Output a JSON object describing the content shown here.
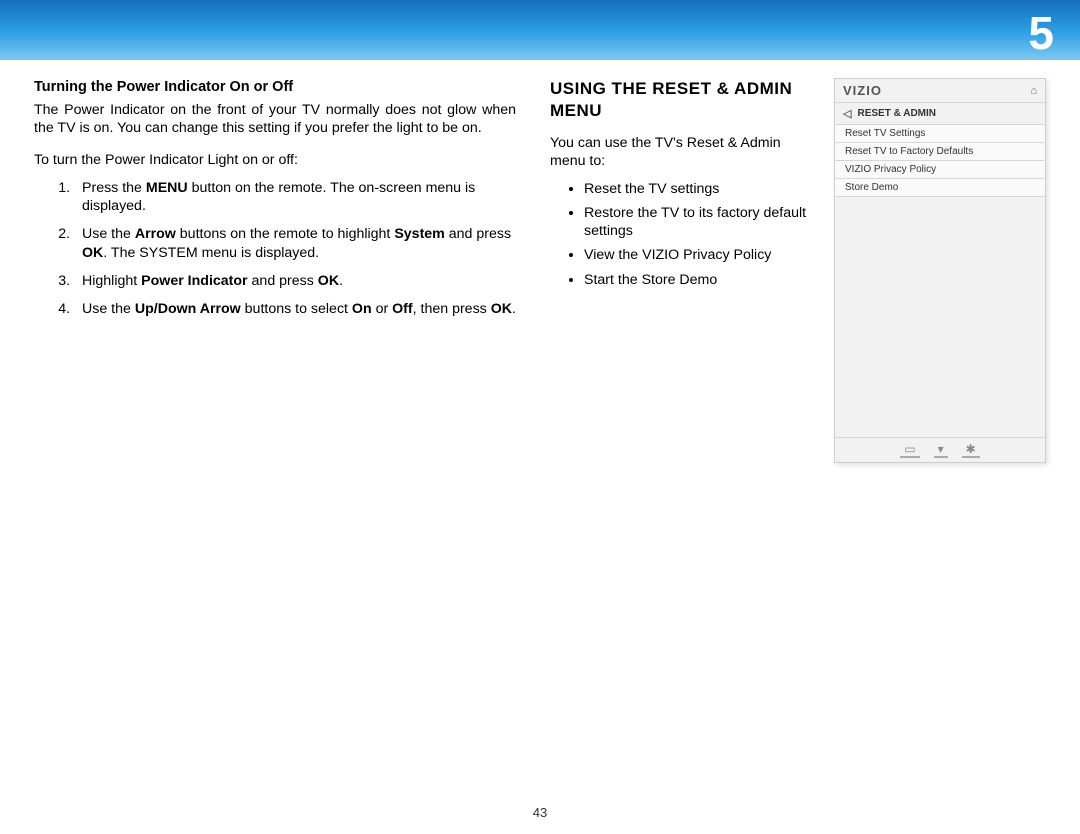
{
  "chapter": "5",
  "page_number": "43",
  "left": {
    "heading": "Turning the Power Indicator On or Off",
    "intro": "The Power Indicator on the front of your TV normally does not glow when the TV is on. You can change this setting if you prefer the light to be on.",
    "lead": "To turn the Power Indicator Light on or off:",
    "steps": {
      "s1_a": "Press the ",
      "s1_menu": "MENU",
      "s1_b": " button on the remote. The on-screen menu is displayed.",
      "s2_a": "Use the ",
      "s2_arrow": "Arrow",
      "s2_b": " buttons on the remote to highlight ",
      "s2_system": "System",
      "s2_c": " and press ",
      "s2_ok": "OK",
      "s2_d": ". The SYSTEM menu is displayed.",
      "s3_a": "Highlight ",
      "s3_pi": "Power Indicator",
      "s3_b": " and press ",
      "s3_ok": "OK",
      "s3_c": ".",
      "s4_a": "Use the ",
      "s4_ud": "Up/Down Arrow",
      "s4_b": " buttons to select ",
      "s4_on": "On",
      "s4_or": " or ",
      "s4_off": "Off",
      "s4_c": ", then press ",
      "s4_ok": "OK",
      "s4_d": "."
    }
  },
  "right": {
    "heading": "USING THE RESET & ADMIN MENU",
    "intro": "You can use the TV's Reset & Admin menu to:",
    "bullets": [
      "Reset the TV settings",
      "Restore the TV to its factory default settings",
      "View the VIZIO Privacy Policy",
      "Start the Store Demo"
    ]
  },
  "tv_menu": {
    "brand": "VIZIO",
    "title": "RESET & ADMIN",
    "items": [
      "Reset TV Settings",
      "Reset TV to Factory Defaults",
      "VIZIO Privacy Policy",
      "Store Demo"
    ]
  }
}
